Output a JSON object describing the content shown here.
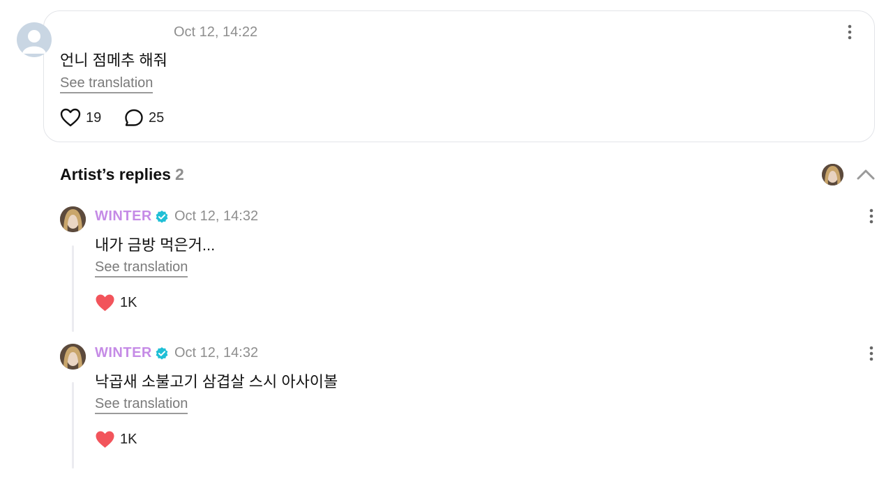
{
  "post": {
    "time": "Oct 12, 14:22",
    "text": "언니 점메추 해줘",
    "translate_label": "See translation",
    "likes": "19",
    "comments": "25"
  },
  "replies_section": {
    "title": "Artist’s replies",
    "count": "2"
  },
  "replies": [
    {
      "author": "WINTER",
      "time": "Oct 12, 14:32",
      "text": "내가 금방 먹은거...",
      "translate_label": "See translation",
      "likes": "1K"
    },
    {
      "author": "WINTER",
      "time": "Oct 12, 14:32",
      "text": "낙곱새 소불고기 삼겹살 스시 아사이볼",
      "translate_label": "See translation",
      "likes": "1K"
    }
  ],
  "colors": {
    "artist_name": "#c58be6",
    "verified_badge": "#1fbfd6",
    "like_filled": "#f2545b",
    "muted_text": "#8e8e8e",
    "card_border": "#e2e4e8"
  },
  "icons": {
    "post_like": "heart-outline-icon",
    "post_comment": "comment-bubble-icon",
    "post_more": "more-vertical-icon",
    "collapse": "chevron-up-icon",
    "verified": "verified-badge-icon",
    "reply_like": "heart-filled-icon"
  }
}
